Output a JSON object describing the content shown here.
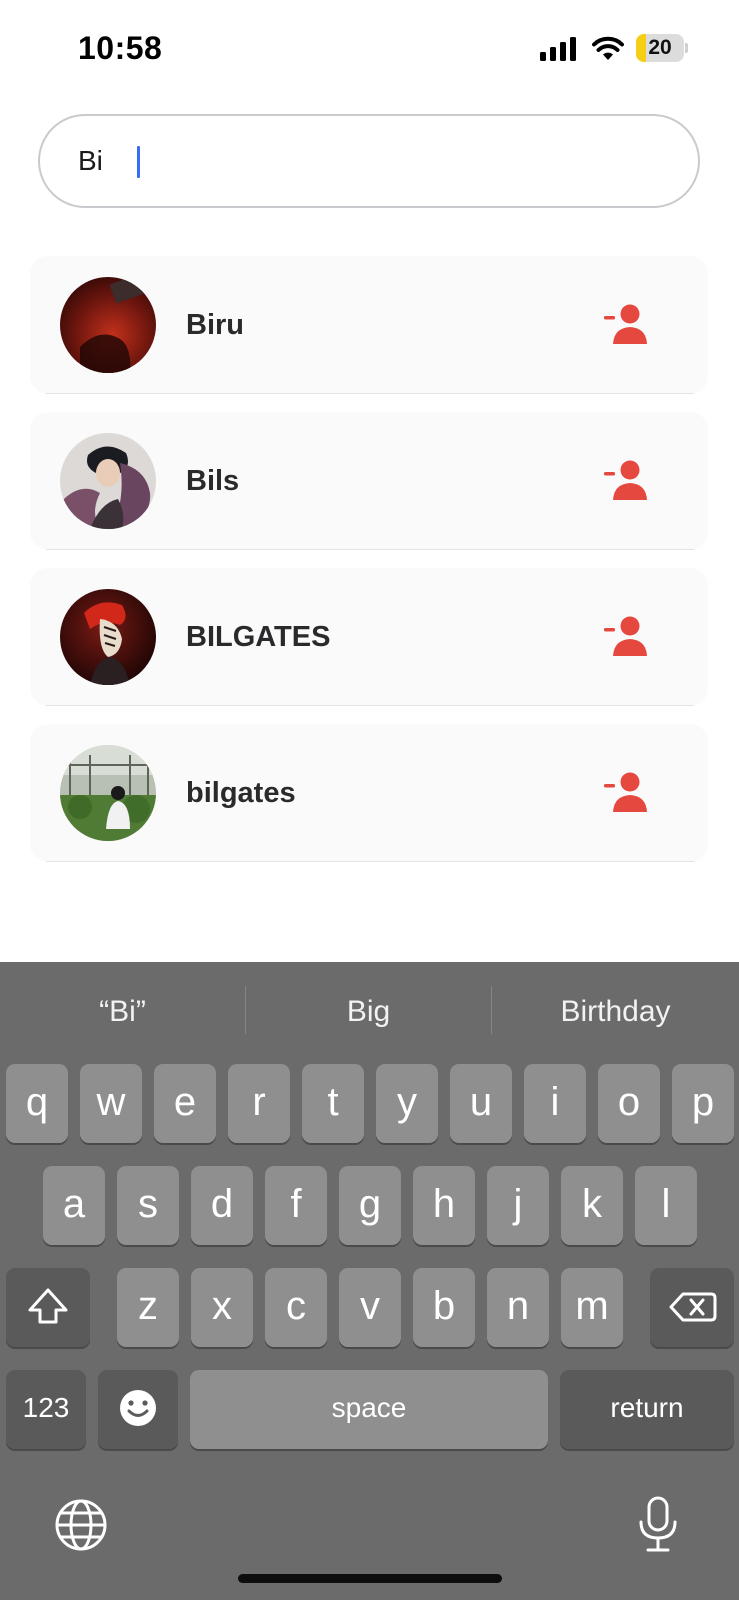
{
  "status_bar": {
    "time": "10:58",
    "battery_level": "20",
    "battery_color": "#f5cf15"
  },
  "search": {
    "value": "Bi",
    "placeholder": ""
  },
  "results": [
    {
      "name": "Biru",
      "avatar_icon": "avatar-dark-red-photo",
      "action_icon": "remove-user-icon"
    },
    {
      "name": "Bils",
      "avatar_icon": "avatar-anime-character",
      "action_icon": "remove-user-icon"
    },
    {
      "name": "BILGATES",
      "avatar_icon": "avatar-red-hair-character",
      "action_icon": "remove-user-icon"
    },
    {
      "name": "bilgates",
      "avatar_icon": "avatar-outdoor-photo",
      "action_icon": "remove-user-icon"
    }
  ],
  "colors": {
    "accent_remove": "#e5483f",
    "keyboard_bg": "#6b6b6b"
  },
  "keyboard": {
    "suggestions": [
      "“Bi”",
      "Big",
      "Birthday"
    ],
    "row1": [
      "q",
      "w",
      "e",
      "r",
      "t",
      "y",
      "u",
      "i",
      "o",
      "p"
    ],
    "row2": [
      "a",
      "s",
      "d",
      "f",
      "g",
      "h",
      "j",
      "k",
      "l"
    ],
    "row3": [
      "z",
      "x",
      "c",
      "v",
      "b",
      "n",
      "m"
    ],
    "numbers_label": "123",
    "space_label": "space",
    "return_label": "return"
  }
}
